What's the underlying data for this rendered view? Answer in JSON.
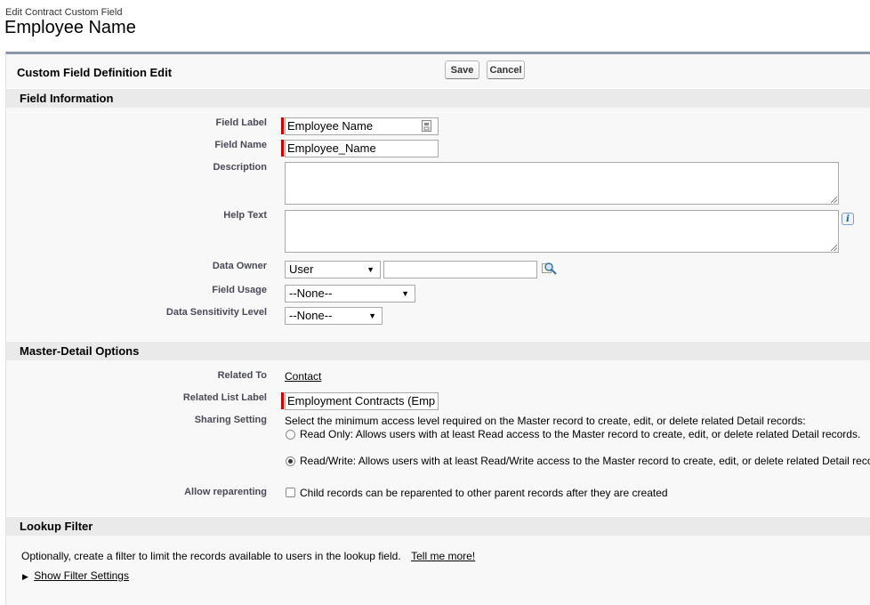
{
  "header": {
    "breadcrumb": "Edit Contract Custom Field",
    "title": "Employee Name"
  },
  "panel": {
    "title": "Custom Field Definition Edit",
    "save_label": "Save",
    "cancel_label": "Cancel"
  },
  "sections": {
    "field_info": "Field Information",
    "master_detail": "Master-Detail Options",
    "lookup_filter": "Lookup Filter"
  },
  "field_info": {
    "field_label": {
      "label": "Field Label",
      "value": "Employee Name"
    },
    "field_name": {
      "label": "Field Name",
      "value": "Employee_Name"
    },
    "description": {
      "label": "Description",
      "value": ""
    },
    "help_text": {
      "label": "Help Text",
      "value": ""
    },
    "data_owner": {
      "label": "Data Owner",
      "selected": "User",
      "value": ""
    },
    "field_usage": {
      "label": "Field Usage",
      "selected": "--None--"
    },
    "data_sensitivity": {
      "label": "Data Sensitivity Level",
      "selected": "--None--"
    }
  },
  "master_detail": {
    "related_to": {
      "label": "Related To",
      "value": "Contact"
    },
    "related_list_label": {
      "label": "Related List Label",
      "value": "Employment Contracts (Emp"
    },
    "sharing_setting": {
      "label": "Sharing Setting",
      "intro": "Select the minimum access level required on the Master record to create, edit, or delete related Detail records:",
      "options": [
        {
          "text": "Read Only: Allows users with at least Read access to the Master record to create, edit, or delete related Detail records.",
          "selected": false
        },
        {
          "text": "Read/Write: Allows users with at least Read/Write access to the Master record to create, edit, or delete related Detail reco",
          "selected": true
        }
      ]
    },
    "allow_reparenting": {
      "label": "Allow reparenting",
      "text": "Child records can be reparented to other parent records after they are created",
      "checked": false
    }
  },
  "lookup_filter": {
    "description": "Optionally, create a filter to limit the records available to users in the lookup field.",
    "tell_me_more": "Tell me more!",
    "show_settings": "Show Filter Settings"
  },
  "colors": {
    "required_bar": "#cc0000",
    "panel_border": "#8a96a6",
    "section_bg": "#eaeaea"
  }
}
